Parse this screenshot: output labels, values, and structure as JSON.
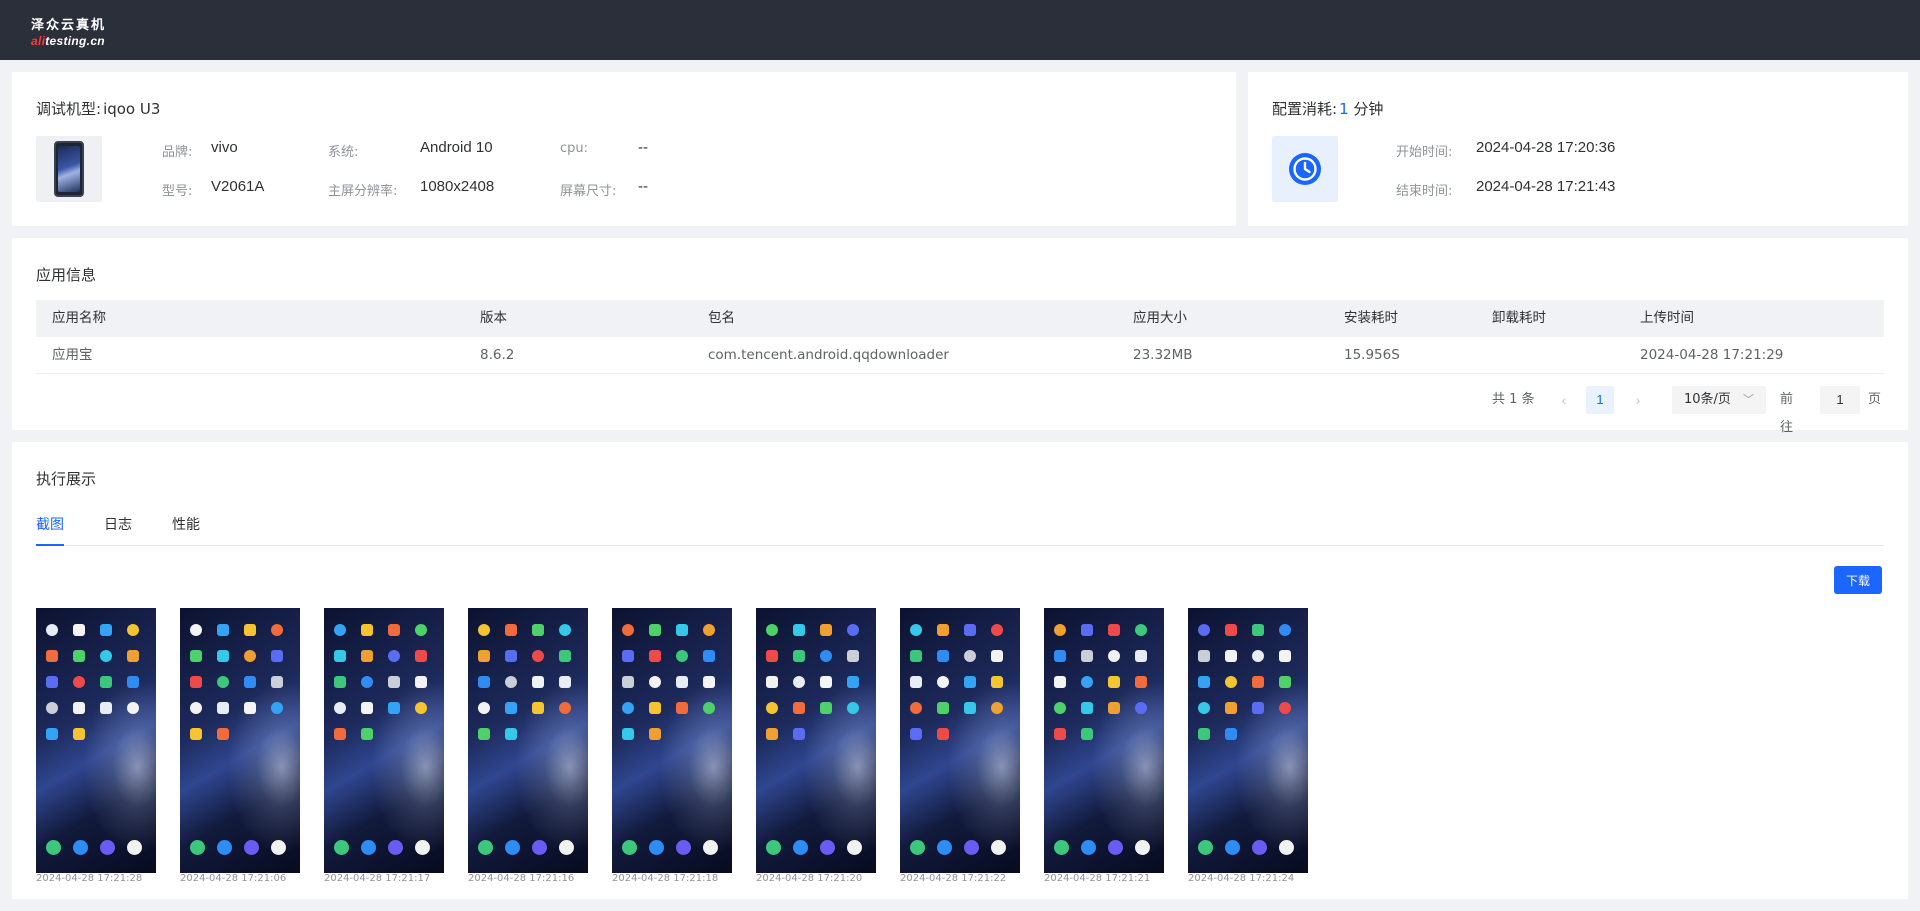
{
  "header": {
    "logo_title": "泽众云真机",
    "logo_sub_red": "ali",
    "logo_sub_white": "testing.cn"
  },
  "device": {
    "title_label": "调试机型:",
    "title_value": "iqoo U3",
    "fields": [
      {
        "label": "品牌:",
        "value": "vivo"
      },
      {
        "label": "系统:",
        "value": "Android 10"
      },
      {
        "label": "cpu:",
        "value": "--"
      },
      {
        "label": "型号:",
        "value": "V2061A"
      },
      {
        "label": "主屏分辨率:",
        "value": "1080x2408"
      },
      {
        "label": "屏幕尺寸:",
        "value": "--"
      }
    ]
  },
  "config": {
    "title_label": "配置消耗:",
    "minutes": "1",
    "unit": "分钟",
    "start_label": "开始时间:",
    "start_value": "2024-04-28 17:20:36",
    "end_label": "结束时间:",
    "end_value": "2024-04-28 17:21:43"
  },
  "app_info": {
    "title": "应用信息",
    "columns": [
      "应用名称",
      "版本",
      "包名",
      "应用大小",
      "安装耗时",
      "卸载耗时",
      "上传时间"
    ],
    "rows": [
      [
        "应用宝",
        "8.6.2",
        "com.tencent.android.qqdownloader",
        "23.32MB",
        "15.956S",
        "",
        "2024-04-28 17:21:29"
      ]
    ]
  },
  "pagination": {
    "total": "共 1 条",
    "prev": "‹",
    "next": "›",
    "current": "1",
    "page_size": "10条/页",
    "goto_label": "前往",
    "goto_value": "1",
    "page_suffix": "页"
  },
  "exec": {
    "title": "执行展示",
    "tabs": [
      "截图",
      "日志",
      "性能"
    ],
    "active_tab": 0,
    "download_label": "下载",
    "screenshots": [
      {
        "time": "2024-04-28 17:21:28"
      },
      {
        "time": "2024-04-28 17:21:06"
      },
      {
        "time": "2024-04-28 17:21:17"
      },
      {
        "time": "2024-04-28 17:21:16"
      },
      {
        "time": "2024-04-28 17:21:18"
      },
      {
        "time": "2024-04-28 17:21:20"
      },
      {
        "time": "2024-04-28 17:21:22"
      },
      {
        "time": "2024-04-28 17:21:21"
      },
      {
        "time": "2024-04-28 17:21:24"
      }
    ]
  },
  "colors": {
    "accent": "#1a66ff",
    "header_bg": "#2b2f3a",
    "logo_red": "#ff3b3b"
  },
  "icons": {
    "clock": "clock-icon",
    "phone": "phone-thumbnail",
    "chevron": "chevron-down-icon"
  }
}
